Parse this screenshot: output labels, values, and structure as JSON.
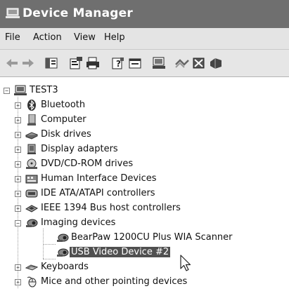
{
  "window": {
    "title": "Device Manager"
  },
  "menu": [
    {
      "label": "File"
    },
    {
      "label": "Action"
    },
    {
      "label": "View"
    },
    {
      "label": "Help"
    }
  ],
  "toolbar": {
    "buttons": [
      "back-icon",
      "forward-icon",
      "show-hide-console-tree-icon",
      "properties-icon",
      "print-icon",
      "help-icon",
      "details-icon",
      "scan-hardware-icon",
      "uninstall-icon",
      "disable-icon",
      "update-driver-icon"
    ]
  },
  "tree": {
    "root": {
      "label": "TEST3"
    },
    "categories": [
      {
        "label": "Bluetooth"
      },
      {
        "label": "Computer"
      },
      {
        "label": "Disk drives"
      },
      {
        "label": "Display adapters"
      },
      {
        "label": "DVD/CD-ROM drives"
      },
      {
        "label": "Human Interface Devices"
      },
      {
        "label": "IDE ATA/ATAPI controllers"
      },
      {
        "label": "IEEE 1394 Bus host controllers"
      },
      {
        "label": "Imaging devices",
        "expanded": true,
        "children": [
          {
            "label": "BearPaw 1200CU Plus WIA Scanner"
          },
          {
            "label": "USB Video Device #2",
            "selected": true
          }
        ]
      },
      {
        "label": "Keyboards"
      },
      {
        "label": "Mice and other pointing devices"
      }
    ]
  },
  "colors": {
    "titlebar": "#6f6f6f",
    "selection": "#505050",
    "background": "#ffffff"
  }
}
